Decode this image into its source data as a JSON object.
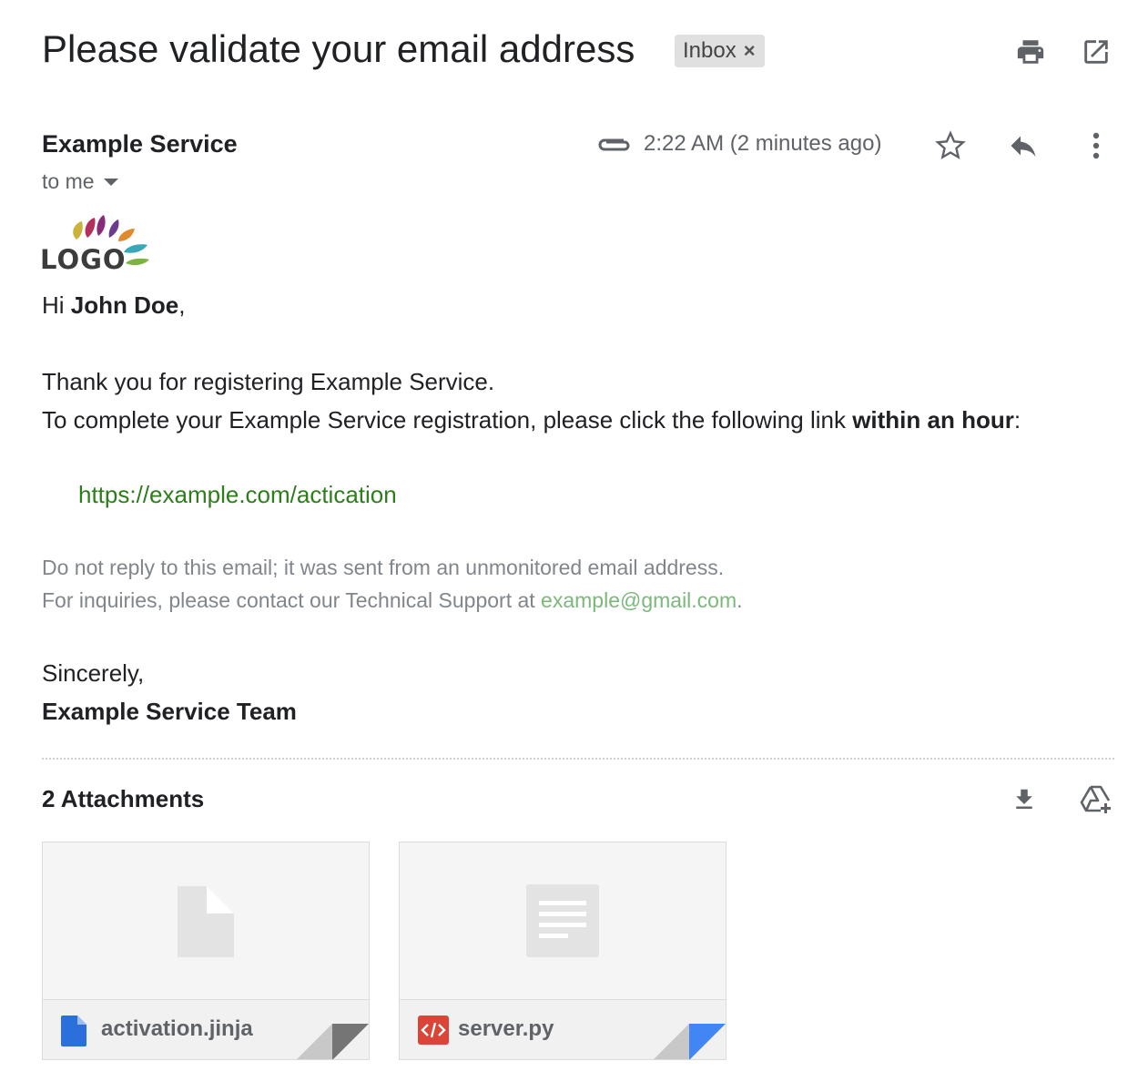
{
  "email": {
    "subject": "Please validate your email address",
    "label": "Inbox",
    "label_remove": "×",
    "sender": "Example Service",
    "recipient": "to me",
    "time": "2:22 AM (2 minutes ago)"
  },
  "logo": {
    "text": "LOGO"
  },
  "body": {
    "greeting_prefix": "Hi ",
    "greeting_name": "John Doe",
    "greeting_suffix": ",",
    "line1": "Thank you for registering Example Service.",
    "line2_prefix": "To complete your Example Service registration, please click the following link ",
    "line2_bold": "within an hour",
    "line2_suffix": ":",
    "link": "https://example.com/actication",
    "note1": "Do not reply to this email; it was sent from an unmonitored email address.",
    "note2_prefix": "For inquiries, please contact our Technical Support at ",
    "note2_link": "example@gmail.com",
    "note2_suffix": ".",
    "closing": "Sincerely,",
    "signature": "Example Service Team"
  },
  "attachments": {
    "title": "2 Attachments",
    "files": [
      {
        "name": "activation.jinja",
        "icon": "doc-blue-icon",
        "corner_color": "#757575"
      },
      {
        "name": "server.py",
        "icon": "code-red-icon",
        "corner_color": "#4285f4"
      }
    ]
  },
  "icons": {
    "print": "print-icon",
    "open_new": "open-in-new-window-icon",
    "attachment": "paperclip-icon",
    "star": "star-icon",
    "reply": "reply-icon",
    "more": "more-vertical-icon",
    "download_all": "download-icon",
    "add_to_drive": "add-to-drive-icon"
  }
}
